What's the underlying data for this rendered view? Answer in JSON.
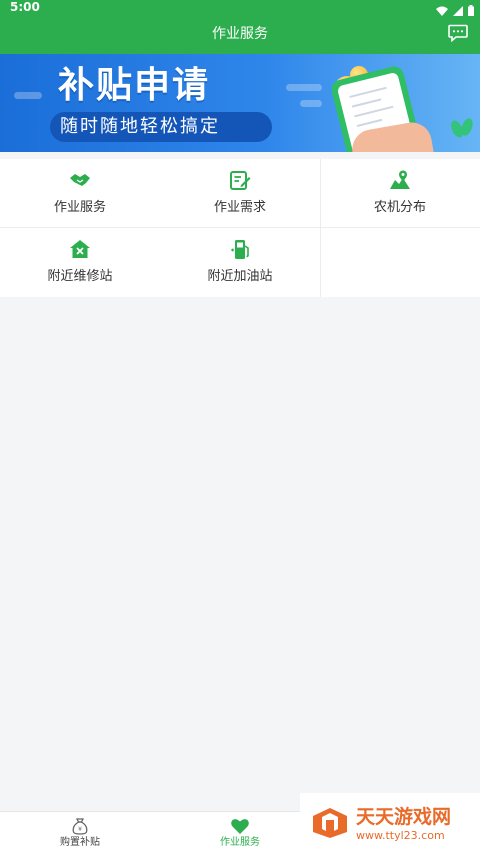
{
  "status_bar": {
    "time": "5:00"
  },
  "header": {
    "title": "作业服务"
  },
  "banner": {
    "title": "补贴申请",
    "subtitle": "随时随地轻松搞定"
  },
  "menu": {
    "items": [
      {
        "label": "作业服务",
        "icon": "handshake-icon"
      },
      {
        "label": "作业需求",
        "icon": "edit-document-icon"
      },
      {
        "label": "农机分布",
        "icon": "map-pin-icon"
      },
      {
        "label": "附近维修站",
        "icon": "repair-house-icon"
      },
      {
        "label": "附近加油站",
        "icon": "gas-station-icon"
      }
    ]
  },
  "bottom_nav": {
    "tabs": [
      {
        "label": "购置补贴",
        "icon": "money-bag-icon",
        "active": false
      },
      {
        "label": "作业服务",
        "icon": "heart-icon",
        "active": true
      }
    ]
  },
  "watermark": {
    "text": "天天游戏网",
    "url": "www.ttyl23.com"
  },
  "colors": {
    "primary": "#2dae4e",
    "banner_blue": "#1b6ed8",
    "background": "#f4f5f7",
    "watermark_orange": "#e86b2a"
  }
}
